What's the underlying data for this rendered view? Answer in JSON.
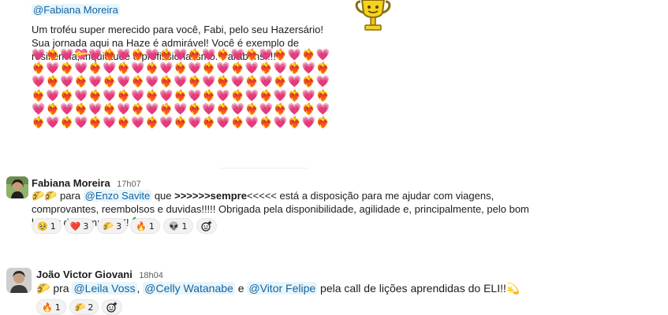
{
  "post1": {
    "mention": "@Fabiana Moreira",
    "text": "Um troféu super merecido para você, Fabi, pelo seu Hazersário! Sua jornada aqui na Haze é admirável! Você é exemplo de resiliência, inquietude e profissionalismo. Parabéns!!!! ",
    "hearts": "💗❤️‍🔥💗💝💗❤️‍🔥💗❤️‍🔥💗❤️‍🔥💗❤️‍🔥💗❤️‍🔥💗❤️‍🔥💗❤️‍🔥💗❤️‍🔥💗❤️‍🔥💗❤️‍🔥💗❤️‍🔥💗❤️‍🔥💗❤️‍🔥💗❤️‍🔥💗❤️‍🔥💗❤️‍🔥💗❤️‍🔥💗❤️‍🔥💗❤️‍🔥💗❤️‍🔥💗❤️‍🔥💗❤️‍🔥💗❤️‍🔥💗❤️‍🔥💗❤️‍🔥💗❤️‍🔥💗❤️‍🔥💗❤️‍🔥💗❤️‍🔥💗❤️‍🔥💗❤️‍🔥💗❤️‍🔥💗❤️‍🔥💗❤️‍🔥💗❤️‍🔥💗❤️‍🔥💗❤️‍🔥💗❤️‍🔥💗❤️‍🔥💗❤️‍🔥💗❤️‍🔥💗❤️‍🔥💗❤️‍🔥💗❤️‍🔥💗❤️‍🔥💗❤️‍🔥💗❤️‍🔥💗❤️‍🔥💗❤️‍🔥💗❤️‍🔥💗❤️‍🔥💗❤️‍🔥💗❤️‍🔥💗❤️‍🔥💗❤️‍🔥💗❤️‍🔥💗❤️‍🔥💗❤️‍🔥💗❤️‍🔥💗❤️‍🔥💗❤️‍🔥"
  },
  "post2": {
    "author": "Fabiana Moreira",
    "time": "17h07",
    "emoji_prefix": "🌮🌮",
    "para": " para ",
    "mention": "@Enzo Savite",
    "text_a": " que ",
    "bold": ">>>>>>sempre",
    "text_b": "<<<<< está a disposição para me ajudar com viagens, comprovantes, reembolsos e duvidas!!!!! Obrigada pela disponibilidade, agilidade e, principalmente, pelo bom humor de sempre!!!!!! 🦕",
    "reactions": [
      {
        "emoji": "🥹",
        "count": "1"
      },
      {
        "emoji": "❤️",
        "count": "3"
      },
      {
        "emoji": "🌮",
        "count": "3"
      },
      {
        "emoji": "🔥",
        "count": "1"
      },
      {
        "emoji": "👽",
        "count": "1"
      }
    ]
  },
  "post3": {
    "author": "João Victor Giovani",
    "time": "18h04",
    "emoji_prefix": "🌮",
    "pra": " pra ",
    "mention1": "@Leila Voss",
    "sep1": ", ",
    "mention2": "@Celly Watanabe",
    "sep2": " e ",
    "mention3": "@Vitor Felipe",
    "text": " pela call de lições aprendidas do ELI!!",
    "sparkle": "💫",
    "reactions": [
      {
        "emoji": "🔥",
        "count": "1"
      },
      {
        "emoji": "🌮",
        "count": "2"
      }
    ]
  },
  "icons": {
    "add_reaction": "add-reaction-icon",
    "trophy": "trophy-icon"
  }
}
